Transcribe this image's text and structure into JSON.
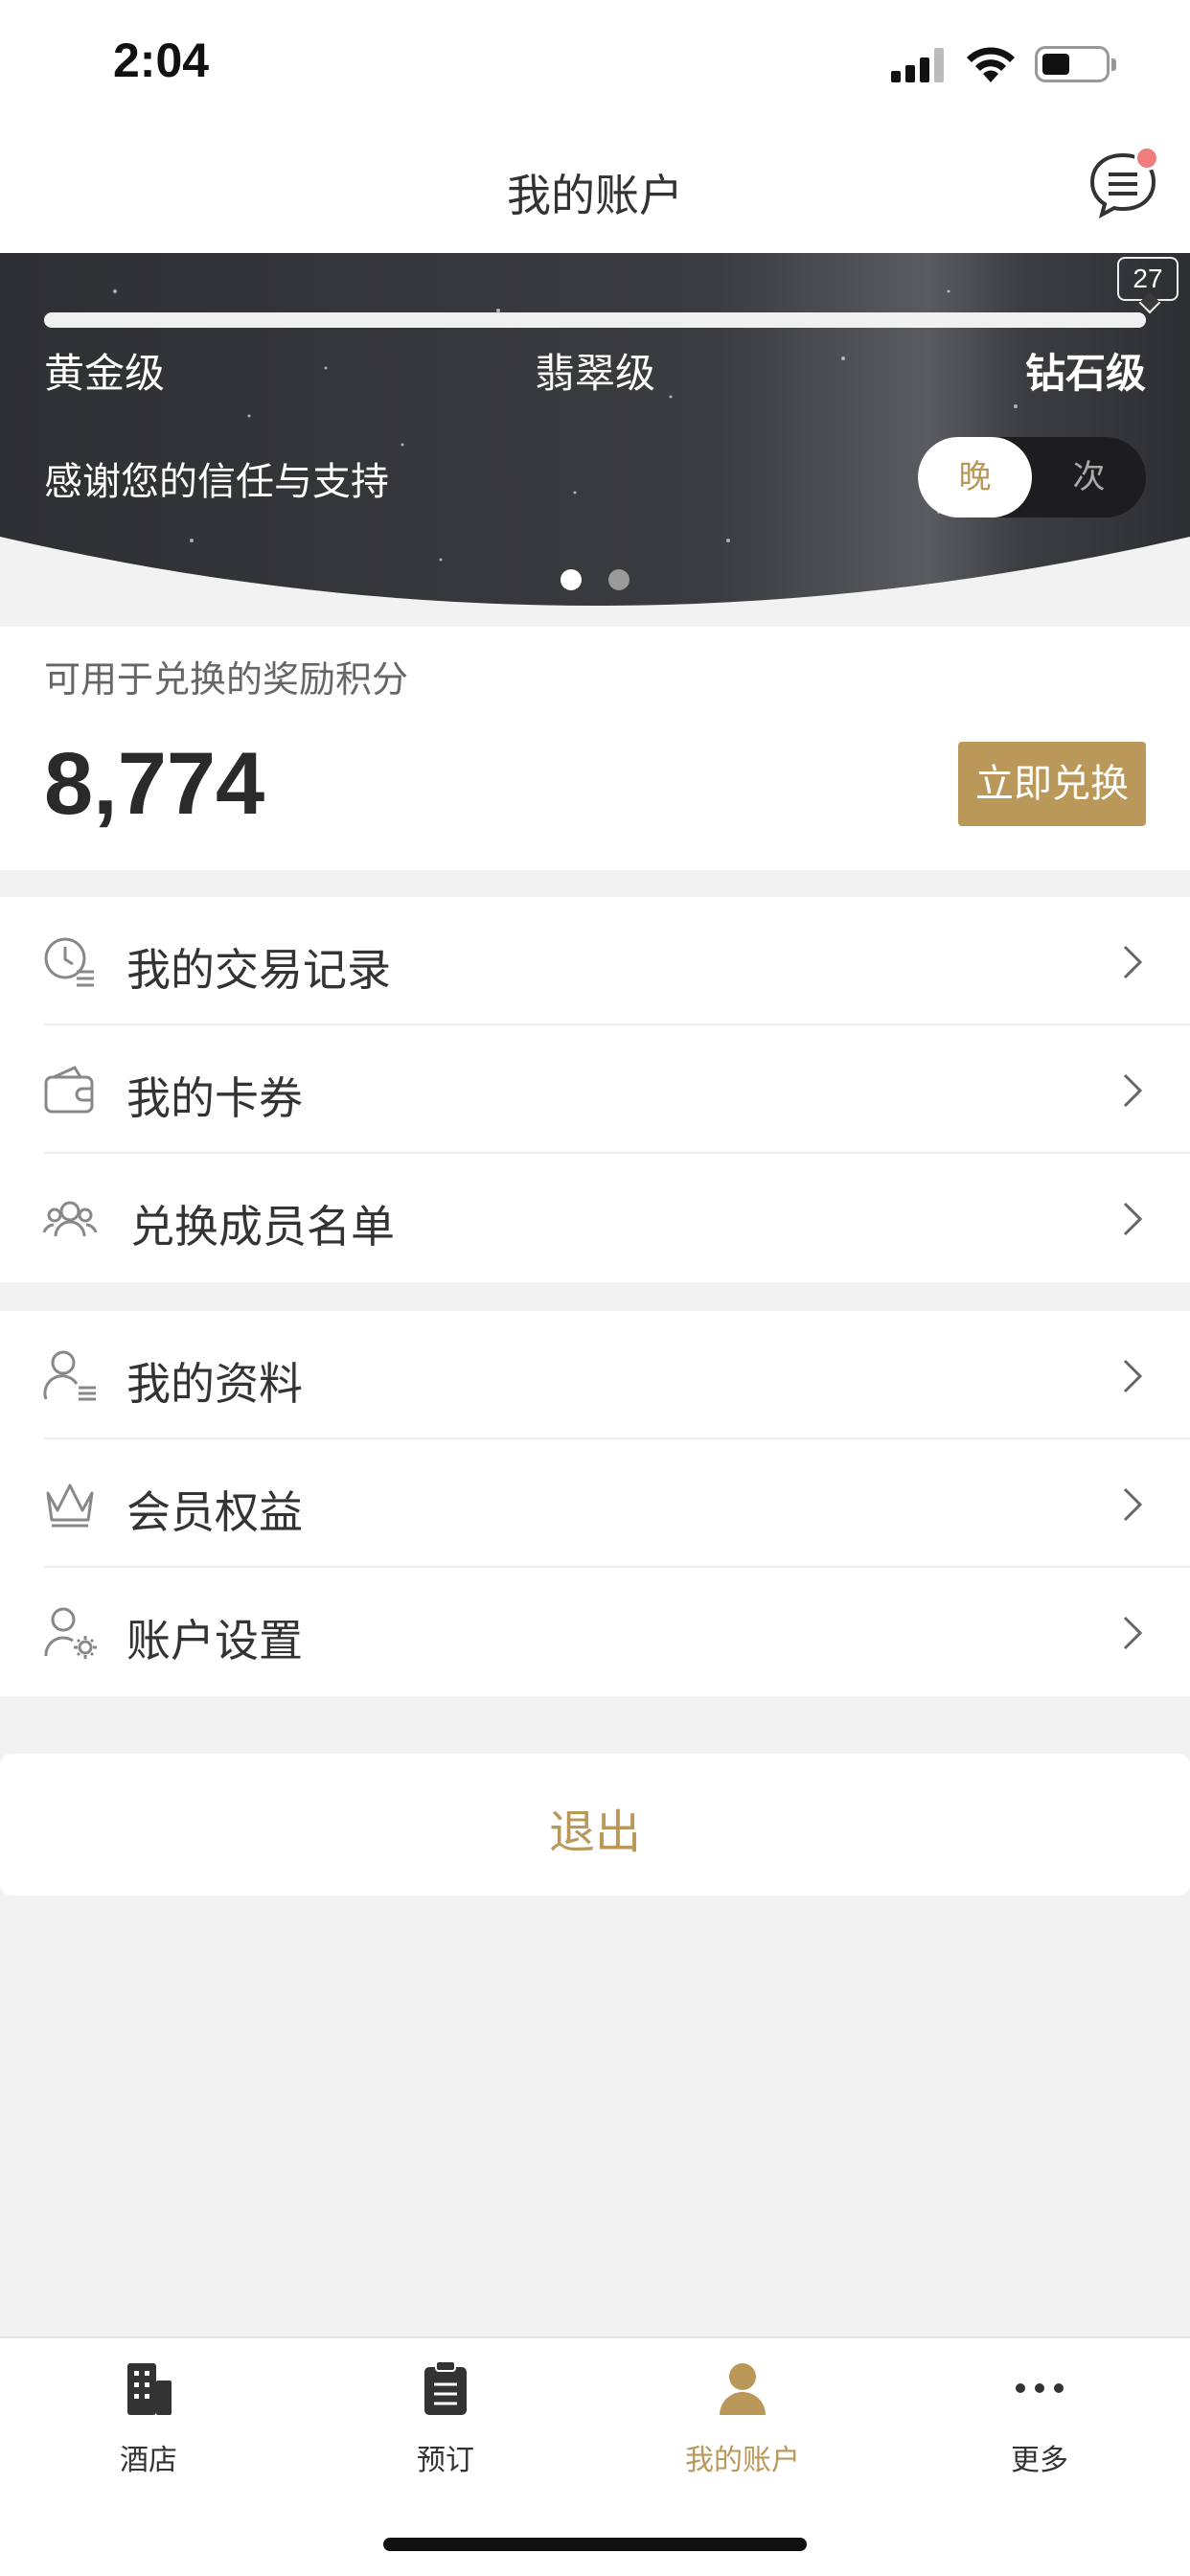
{
  "status_bar": {
    "time": "2:04"
  },
  "header": {
    "title": "我的账户"
  },
  "hero": {
    "nights_badge": "27",
    "progress_fraction": 1.0,
    "tiers": [
      "黄金级",
      "翡翠级",
      "钻石级"
    ],
    "thanks_text": "感谢您的信任与支持",
    "toggle": {
      "option_on": "晚",
      "option_off": "次"
    },
    "page_dots": 2,
    "active_dot": 0
  },
  "points": {
    "label": "可用于兑换的奖励积分",
    "value": "8,774",
    "redeem_button": "立即兑换"
  },
  "menu_group_1": [
    {
      "label": "我的交易记录",
      "icon": "transaction-history-icon"
    },
    {
      "label": "我的卡券",
      "icon": "wallet-icon"
    },
    {
      "label": "兑换成员名单",
      "icon": "members-icon"
    }
  ],
  "menu_group_2": [
    {
      "label": "我的资料",
      "icon": "profile-icon"
    },
    {
      "label": "会员权益",
      "icon": "crown-icon"
    },
    {
      "label": "账户设置",
      "icon": "user-settings-icon"
    }
  ],
  "logout_label": "退出",
  "tabs": [
    {
      "label": "酒店",
      "icon": "hotel-icon",
      "active": false
    },
    {
      "label": "预订",
      "icon": "booking-icon",
      "active": false
    },
    {
      "label": "我的账户",
      "icon": "account-icon",
      "active": true
    },
    {
      "label": "更多",
      "icon": "more-icon",
      "active": false
    }
  ],
  "colors": {
    "accent": "#b9985a",
    "badge": "#f07d7d"
  }
}
